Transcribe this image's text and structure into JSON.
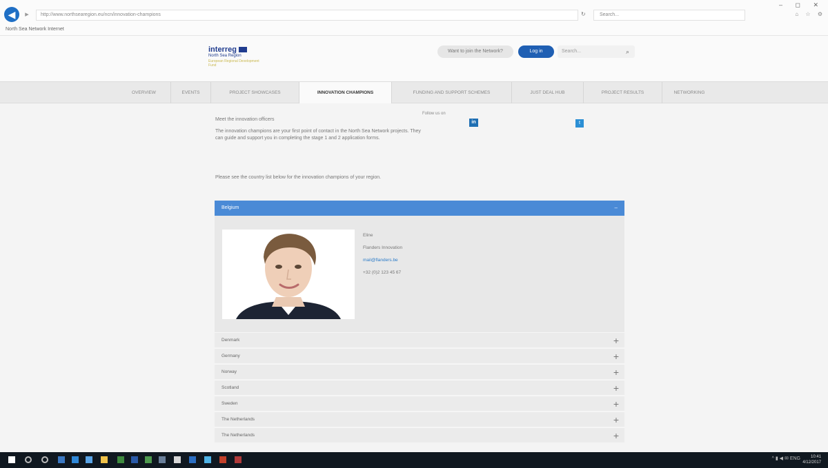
{
  "browser": {
    "url": "http://www.northsearegion.eu/ncn/innovation-champions",
    "search_placeholder": "Search...",
    "tab_title": "North Sea Network Internet",
    "window_controls": "– ◻ ✕",
    "tool_icons": "⌂ ☆ ⚙"
  },
  "site": {
    "logo_title": "interreg",
    "logo_subtitle": "North Sea Region",
    "logo_tagline": "European Regional Development Fund",
    "find_button": "Want to join the Network?",
    "login_button": "Log in",
    "search_placeholder": "Search..."
  },
  "nav": [
    {
      "label": "Overview"
    },
    {
      "label": "Events"
    },
    {
      "label": "Project Showcases"
    },
    {
      "label": "Innovation Champions"
    },
    {
      "label": "Funding and Support Schemes"
    },
    {
      "label": "Just Deal Hub"
    },
    {
      "label": "Project Results"
    },
    {
      "label": "Networking"
    }
  ],
  "intro": {
    "title": "Meet the innovation officers",
    "text": "The innovation champions are your first point of contact in the North Sea Network projects. They can guide and support you in completing the stage 1 and 2 application forms.",
    "follow_label": "Follow us on",
    "contact_line": "Please see the country list below for the innovation champions of your region."
  },
  "region": {
    "header": "Belgium",
    "details": {
      "name": "Eline",
      "org": "Flanders Innovation",
      "email": "mail@flanders.be",
      "phone": "+32 (0)2 123 45 67"
    }
  },
  "accordion": [
    {
      "label": "Denmark"
    },
    {
      "label": "Germany"
    },
    {
      "label": "Norway"
    },
    {
      "label": "Scotland"
    },
    {
      "label": "Sweden"
    },
    {
      "label": "The Netherlands"
    },
    {
      "label": "The Netherlands"
    }
  ],
  "taskbar": {
    "clock_time": "10:41",
    "clock_date": "4/12/2017",
    "tray": "^ ▮ ◀ ✉ ENG"
  },
  "colors": {
    "accent": "#4a8ad6",
    "brand": "#203c8f",
    "login": "#1f5fb3"
  }
}
